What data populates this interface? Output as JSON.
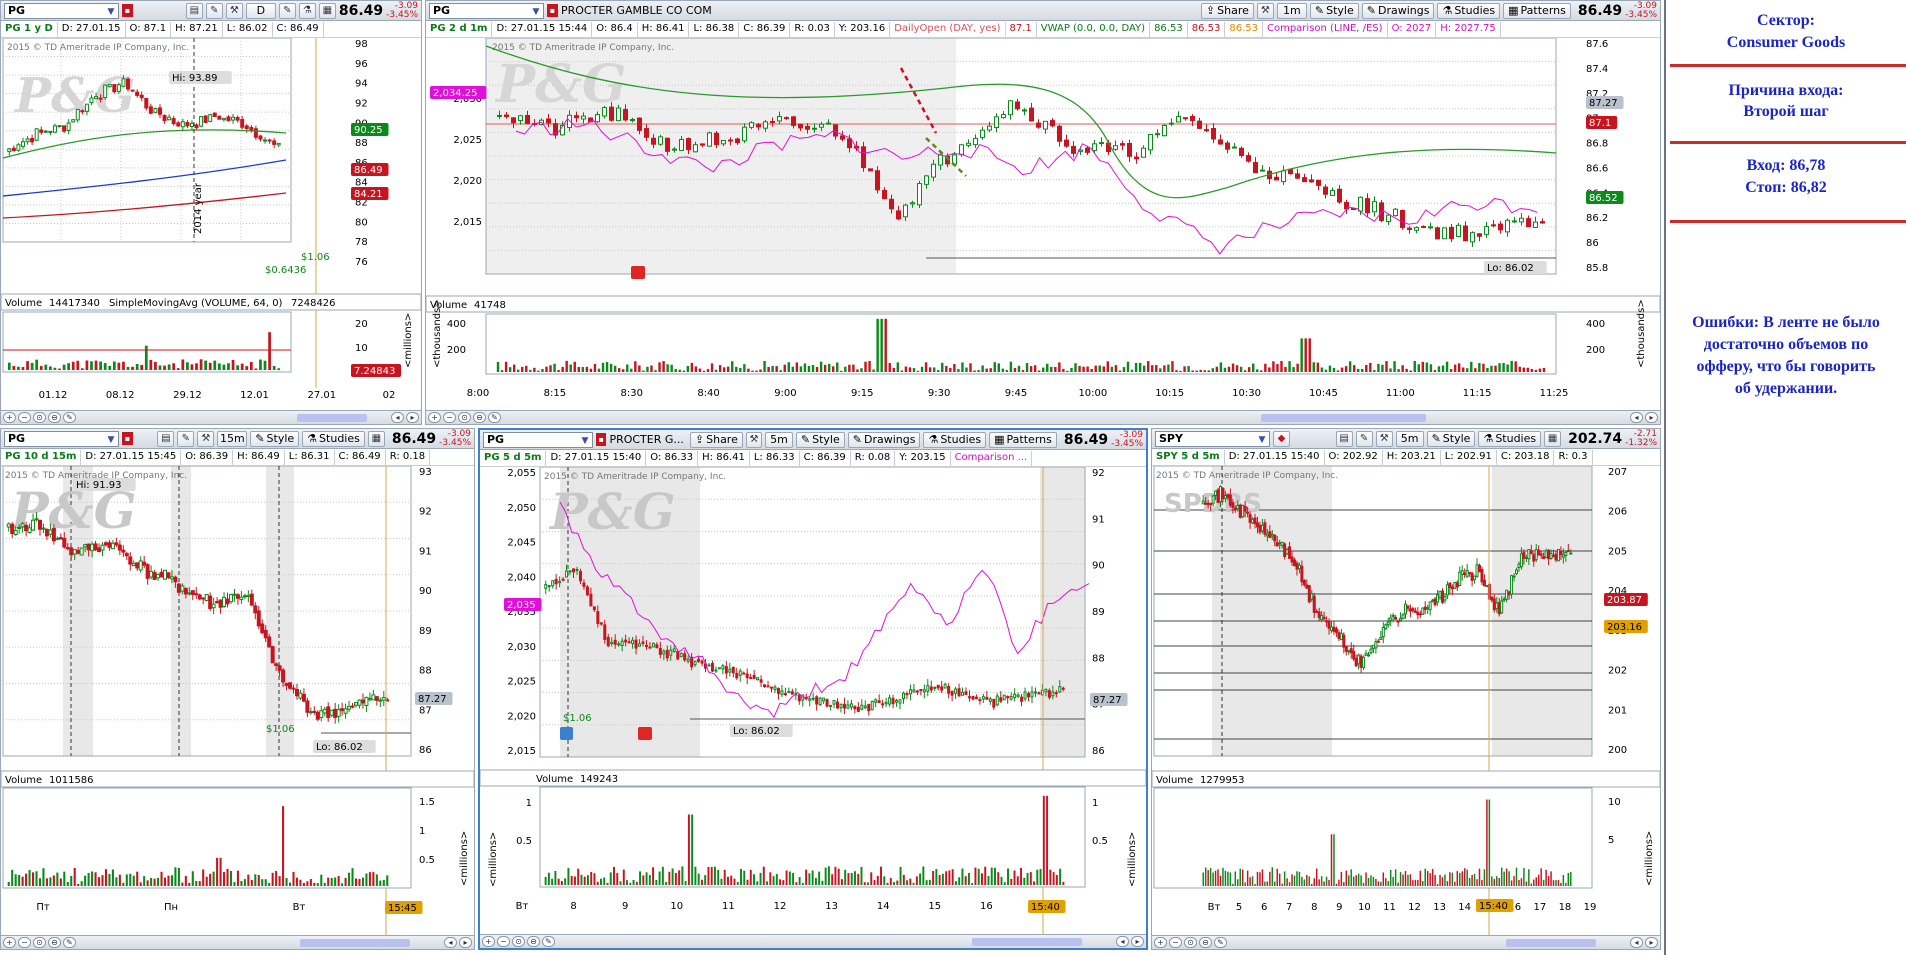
{
  "top_left": {
    "symbol": "PG",
    "aggregation": "D",
    "price": "86.49",
    "change_abs": "-3.09",
    "change_pct": "-3.45%",
    "info": {
      "sym": "PG 1 y D",
      "date": "D: 27.01.15",
      "open": "O: 87.1",
      "high": "H: 87.21",
      "low": "L: 86.02",
      "close": "C: 86.49"
    },
    "hi_label": "Hi: 93.89",
    "year_label": "2014 year",
    "div_label_1": "$0.6436",
    "div_label_2": "$1.06",
    "watermark": "P&G",
    "copyright": "2015 © TD Ameritrade IP Company, Inc.",
    "price_ticks": [
      "98",
      "96",
      "94",
      "92",
      "90",
      "88",
      "86",
      "84",
      "82",
      "80",
      "78",
      "76"
    ],
    "tags": {
      "green": "90.25",
      "red": "86.49",
      "red2": "84.21"
    },
    "volume": {
      "label": "Volume",
      "value": "14417340",
      "study": "SimpleMovingAvg (VOLUME, 64, 0)",
      "study_value": "7248426",
      "tag": "7.24843",
      "unit": "<millions>",
      "ticks": [
        "20",
        "10"
      ]
    },
    "x_ticks": [
      "01.12",
      "08.12",
      "29.12",
      "12.01",
      "27.01",
      "02"
    ]
  },
  "top_main": {
    "symbol": "PG",
    "company": "PROCTER GAMBLE CO COM",
    "share": "Share",
    "interval": "1m",
    "style": "Style",
    "drawings": "Drawings",
    "studies": "Studies",
    "patterns": "Patterns",
    "price": "86.49",
    "change_abs": "-3.09",
    "change_pct": "-3.45%",
    "info": {
      "sym": "PG 2 d 1m",
      "date": "D: 27.01.15 15:44",
      "open": "O: 86.4",
      "high": "H: 86.41",
      "low": "L: 86.38",
      "close": "C: 86.39",
      "range": "R: 0.03",
      "y": "Y: 203.16",
      "daily": "DailyOpen (DAY, yes)",
      "daily_val": "87.1",
      "vwap": "VWAP (0.0, 0.0, DAY)",
      "vwap1": "86.53",
      "vwap2": "86.53",
      "vwap3": "86.53",
      "comp": "Comparison (LINE, /ES)",
      "comp_val": "O: 2027",
      "comp_hi": "H: 2027.75"
    },
    "watermark": "P&G",
    "copyright": "2015 © TD Ameritrade IP Company, Inc.",
    "left_ticks": [
      "2,030",
      "2,025",
      "2,020",
      "2,015"
    ],
    "left_tag": "2,034.25",
    "right_ticks": [
      "87.6",
      "87.4",
      "87.2",
      "87",
      "86.8",
      "86.6",
      "86.4",
      "86.2",
      "86",
      "85.8"
    ],
    "tags": {
      "gray": "87.27",
      "red": "87.1",
      "green": "86.52"
    },
    "lo_label": "Lo: 86.02",
    "volume": {
      "label": "Volume",
      "value": "41748",
      "unit": "<thousands>",
      "ticks": [
        "400",
        "200"
      ]
    },
    "x_ticks": [
      "8:00",
      "8:15",
      "8:30",
      "8:40",
      "9:00",
      "9:15",
      "9:30",
      "9:45",
      "10:00",
      "10:15",
      "10:30",
      "10:45",
      "11:00",
      "11:15",
      "11:25"
    ]
  },
  "bottom_left": {
    "symbol": "PG",
    "interval": "15m",
    "style": "Style",
    "studies": "Studies",
    "price": "86.49",
    "change_abs": "-3.09",
    "change_pct": "-3.45%",
    "info": {
      "sym": "PG 10 d 15m",
      "date": "D: 27.01.15 15:45",
      "open": "O: 86.39",
      "high": "H: 86.49",
      "low": "L: 86.31",
      "close": "C: 86.49",
      "range": "R: 0.18"
    },
    "hi_label": "Hi: 91.93",
    "lo_label": "Lo: 86.02",
    "div_label": "$1.06",
    "watermark": "P&G",
    "copyright": "2015 © TD Ameritrade IP Company, Inc.",
    "price_ticks": [
      "93",
      "92",
      "91",
      "90",
      "89",
      "88",
      "87",
      "86"
    ],
    "tag": "87.27",
    "volume": {
      "label": "Volume",
      "value": "1011586",
      "unit": "<millions>",
      "ticks": [
        "1.5",
        "1",
        "0.5"
      ]
    },
    "x_ticks": [
      "Пт",
      "Пн",
      "Вт"
    ],
    "time_tag": "15:45"
  },
  "bottom_mid": {
    "symbol": "PG",
    "company": "PROCTER G...",
    "share": "Share",
    "interval": "5m",
    "style": "Style",
    "drawings": "Drawings",
    "studies": "Studies",
    "patterns": "Patterns",
    "price": "86.49",
    "change_abs": "-3.09",
    "change_pct": "-3.45%",
    "info": {
      "sym": "PG 5 d 5m",
      "date": "D: 27.01.15 15:40",
      "open": "O: 86.33",
      "high": "H: 86.41",
      "low": "L: 86.33",
      "close": "C: 86.39",
      "range": "R: 0.08",
      "y": "Y: 203.15",
      "comp": "Comparison ..."
    },
    "lo_label": "Lo: 86.02",
    "div_label": "$1.06",
    "watermark": "P&G",
    "copyright": "2015 © TD Ameritrade IP Company, Inc.",
    "left_ticks": [
      "2,055",
      "2,050",
      "2,045",
      "2,040",
      "2,035",
      "2,030",
      "2,025",
      "2,020",
      "2,015"
    ],
    "left_tag": "2,035",
    "right_ticks": [
      "92",
      "91",
      "90",
      "89",
      "88",
      "87",
      "86"
    ],
    "tag": "87.27",
    "volume": {
      "label": "Volume",
      "value": "149243",
      "unit": "<millions>",
      "ticks": [
        "1",
        "0.5"
      ]
    },
    "x_ticks": [
      "Вт",
      "8",
      "9",
      "10",
      "11",
      "12",
      "13",
      "14",
      "15",
      "16",
      "17"
    ],
    "time_tag": "15:40"
  },
  "bottom_right": {
    "symbol": "SPY",
    "interval": "5m",
    "style": "Style",
    "studies": "Studies",
    "price": "202.74",
    "change_abs": "-2.71",
    "change_pct": "-1.32%",
    "info": {
      "sym": "SPY 5 d 5m",
      "date": "D: 27.01.15 15:40",
      "open": "O: 202.92",
      "high": "H: 203.21",
      "low": "L: 202.91",
      "close": "C: 203.18",
      "range": "R: 0.3"
    },
    "watermark": "SPDRS",
    "copyright": "2015 © TD Ameritrade IP Company, Inc.",
    "price_ticks": [
      "207",
      "206",
      "205",
      "204",
      "203",
      "202",
      "201",
      "200"
    ],
    "tags": {
      "red": "203.87",
      "orange": "203.16"
    },
    "volume": {
      "label": "Volume",
      "value": "1279953",
      "unit": "<millions>",
      "ticks": [
        "10",
        "5"
      ]
    },
    "x_ticks": [
      "Вт",
      "5",
      "6",
      "7",
      "8",
      "9",
      "10",
      "11",
      "12",
      "13",
      "14",
      "15",
      "16",
      "17",
      "18",
      "19"
    ],
    "time_tag": "15:40"
  },
  "notes": {
    "sector_title": "Сектор:",
    "sector_value": "Consumer Goods",
    "reason_title": "Причина входа:",
    "reason_value": "Второй шаг",
    "entry": "Вход: 86,78",
    "stop": "Стоп: 86,82",
    "errors_1": "Ошибки: В ленте не было",
    "errors_2": "достаточно объемов по",
    "errors_3": "офферу, что бы говорить",
    "errors_4": "об удержании."
  },
  "colors": {
    "up": "#0a8a1a",
    "down": "#c8141e",
    "comparison": "#e010d8",
    "sma_green": "#2a9a2a",
    "sma_blue": "#1a3acc",
    "note_text": "#1a24c8",
    "note_sep": "#cc2b2b"
  }
}
